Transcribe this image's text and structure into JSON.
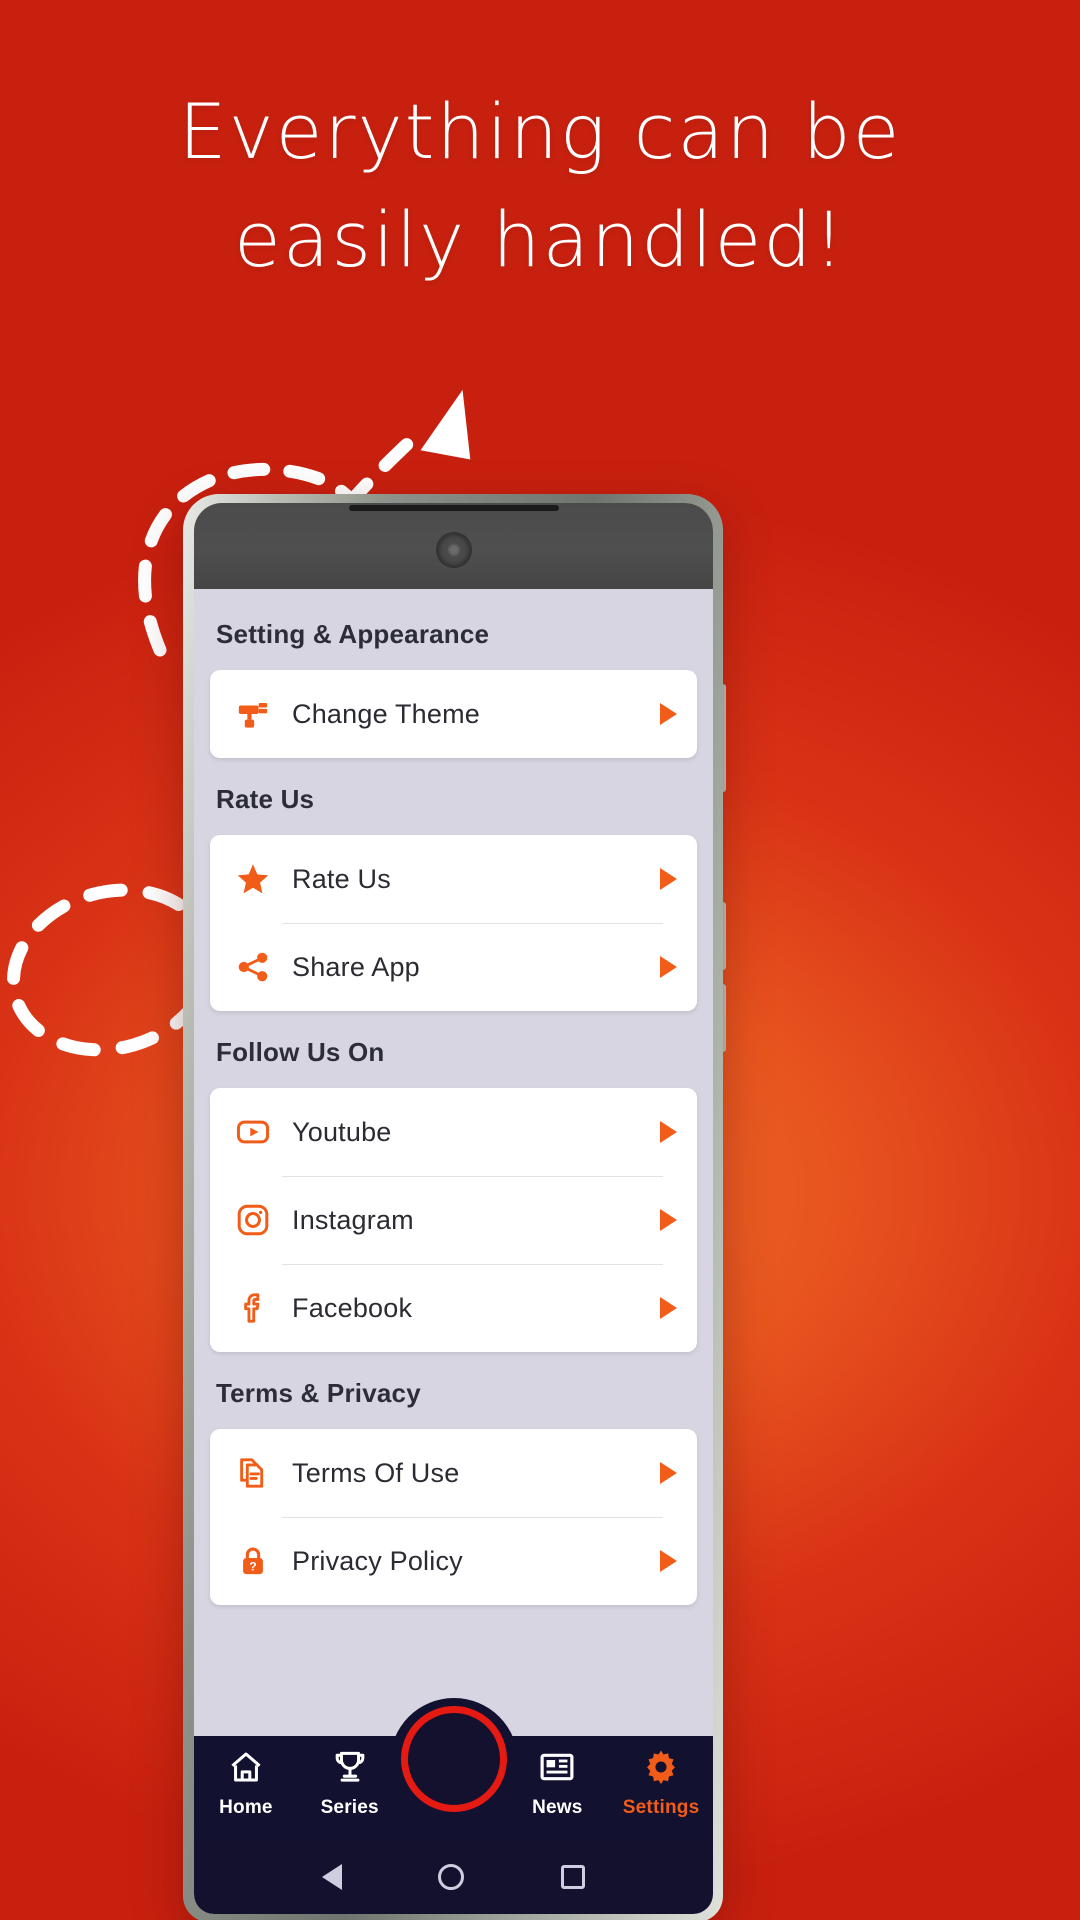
{
  "promo": {
    "headline_line1": "Everything can be",
    "headline_line2": "easily handled!",
    "background_top_color": "#c4230f",
    "background_mid_color": "#e8551f",
    "accent_color": "#f25c19",
    "doodle_color": "#ffffff"
  },
  "phone": {
    "status_bar_color": "#4b4b4b",
    "screen_bg_color": "#d7d5e2"
  },
  "app": {
    "sections": [
      {
        "title": "Setting & Appearance",
        "items": [
          {
            "label": "Change Theme",
            "icon": "paint-roller-icon",
            "arrow": "chevron-right-icon"
          }
        ]
      },
      {
        "title": "Rate Us",
        "items": [
          {
            "label": "Rate Us",
            "icon": "star-icon",
            "arrow": "chevron-right-icon"
          },
          {
            "label": "Share App",
            "icon": "share-icon",
            "arrow": "chevron-right-icon"
          }
        ]
      },
      {
        "title": "Follow Us On",
        "items": [
          {
            "label": "Youtube",
            "icon": "youtube-icon",
            "arrow": "chevron-right-icon"
          },
          {
            "label": "Instagram",
            "icon": "instagram-icon",
            "arrow": "chevron-right-icon"
          },
          {
            "label": "Facebook",
            "icon": "facebook-icon",
            "arrow": "chevron-right-icon"
          }
        ]
      },
      {
        "title": "Terms & Privacy",
        "items": [
          {
            "label": "Terms Of Use",
            "icon": "document-icon",
            "arrow": "chevron-right-icon"
          },
          {
            "label": "Privacy Policy",
            "icon": "lock-question-icon",
            "arrow": "chevron-right-icon"
          }
        ]
      }
    ]
  },
  "bottom_nav": {
    "background_color": "#131130",
    "active_color": "#f25c19",
    "fab": {
      "icon": "record-circle-icon",
      "ring_color": "#e51a12"
    },
    "items": [
      {
        "label": "Home",
        "icon": "home-icon",
        "active": false
      },
      {
        "label": "Series",
        "icon": "trophy-icon",
        "active": false
      },
      {
        "label": "News",
        "icon": "news-icon",
        "active": false
      },
      {
        "label": "Settings",
        "icon": "gear-icon",
        "active": true
      }
    ]
  },
  "system_nav": {
    "back": "back-triangle-icon",
    "home": "home-circle-icon",
    "recents": "recents-square-icon"
  }
}
